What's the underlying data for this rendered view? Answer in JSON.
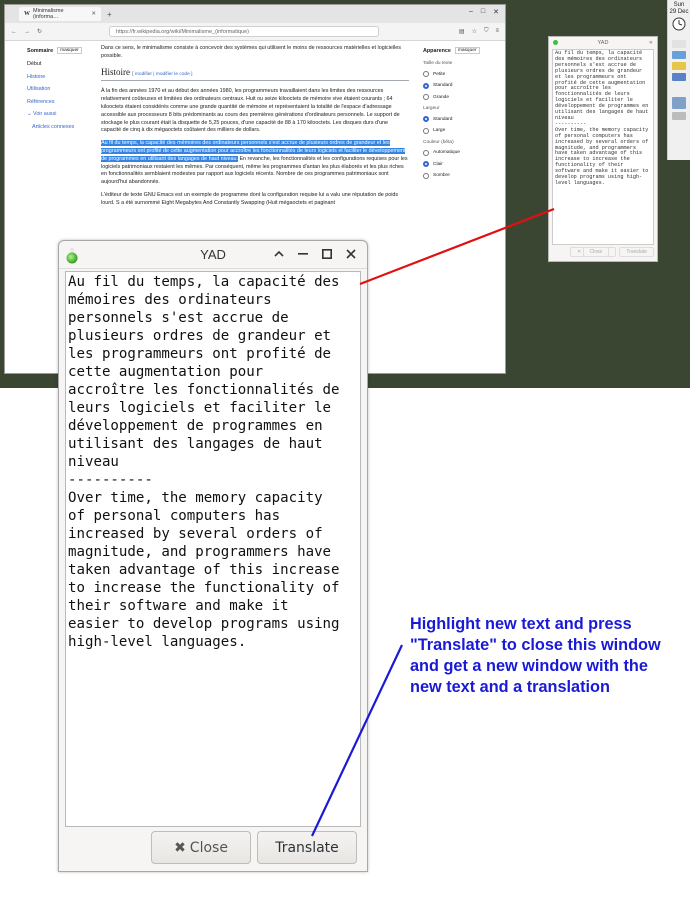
{
  "browser": {
    "tab_title": "Minimalisme (informa…",
    "tab_icon": "W",
    "url": "https://fr.wikipedia.org/wiki/Minimalisme_(informatique)"
  },
  "wiki": {
    "sidebar": {
      "title": "Sommaire",
      "hide": "masquer",
      "items": [
        "Début",
        "Histoire",
        "Utilisation",
        "Références",
        "Voir aussi",
        "Articles connexes"
      ]
    },
    "intro": "Dans ce sens, le minimalisme consiste à concevoir des systèmes qui utilisent le moins de ressources matérielles et logicielles possible.",
    "heading": "Histoire",
    "edit_links": "[ modifier | modifier le code ]",
    "para1": "À la fin des années 1970 et au début des années 1980, les programmeurs travaillaient dans les limites des ressources relativement coûteuses et limitées des ordinateurs centraux. Huit ou seize kilooctets de mémoire vive étaient courants ; 64 kilooctets étaient considérés comme une grande quantité de mémoire et représentaient la totalité de l'espace d'adressage accessible aux processeurs 8 bits prédominants au cours des premières générations d'ordinateurs personnels. Le support de stockage le plus courant était la disquette de 5,25 pouces, d'une capacité de 88 à 170 kilooctets. Les disques durs d'une capacité de cinq à dix mégaoctets coûtaient des milliers de dollars.",
    "para2_highlight": "Au fil du temps, la capacité des mémoires des ordinateurs personnels s'est accrue de plusieurs ordres de grandeur et les programmeurs ont profité de cette augmentation pour accroître les fonctionnalités de leurs logiciels et faciliter le développement de programmes en utilisant des langages de haut niveau.",
    "para2_rest": " En revanche, les fonctionnalités et les configurations requises pour les logiciels patrimoniaux restaient les mêmes. Par conséquent, même les programmes d'antan les plus élaborés et les plus riches en fonctionnalités semblaient modestes par rapport aux logiciels récents. Nombre de ces programmes patrimoniaux sont aujourd'hui abandonnés.",
    "para3": "L'éditeur de texte GNU Emacs est un exemple de programme dont la configuration requise lui a valu une réputation de poids lourd. S a été surnommé Eight Megabytes And Constantly Swapping (Huit mégaoctets et paginant",
    "appearance": {
      "title": "Apparence",
      "hide": "masquer",
      "groups": [
        {
          "label": "Taille du texte",
          "options": [
            "Petite",
            "Standard",
            "Grande"
          ],
          "selected": 1
        },
        {
          "label": "Largeur",
          "options": [
            "Standard",
            "Large"
          ],
          "selected": 0
        },
        {
          "label": "Couleur (bêta)",
          "options": [
            "Automatique",
            "Clair",
            "Sombre"
          ],
          "selected": 1
        }
      ]
    }
  },
  "mini_window": {
    "title": "YAD",
    "text": "Au fil du temps, la capacité des mémoires des ordinateurs personnels s'est accrue de plusieurs ordres de grandeur et les programmeurs ont profité de cette augmentation pour accroître les fonctionnalités de leurs logiciels et faciliter le développement de programmes en utilisant des langages de haut niveau\n----------\nOver time, the memory capacity of personal computers has increased by several orders of magnitude, and programmers have taken advantage of this increase to increase the functionality of their software and make it easier to develop programs using high-level languages.",
    "close": "Close",
    "translate": "Translate"
  },
  "panel": {
    "day": "Sun",
    "date": "29 Dec"
  },
  "yad": {
    "title": "YAD",
    "text": "Au fil du temps, la capacité des\nmémoires des ordinateurs\npersonnels s'est accrue de\nplusieurs ordres de grandeur et\nles programmeurs ont profité de\ncette augmentation pour\naccroître les fonctionnalités de\nleurs logiciels et faciliter le\ndéveloppement de programmes en\nutilisant des langages de haut\nniveau\n----------\nOver time, the memory capacity\nof personal computers has\nincreased by several orders of\nmagnitude, and programmers have\ntaken advantage of this increase\nto increase the functionality of\ntheir software and make it\neasier to develop programs using\nhigh-level languages.",
    "close_label": "Close",
    "translate_label": "Translate"
  },
  "annotation": "Highlight new text and press \"Translate\" to close this window and get a new window with the new text and a translation",
  "colors": {
    "annotation": "#1a1ad6",
    "red_arrow": "#e01010",
    "highlight": "#3584e4"
  }
}
